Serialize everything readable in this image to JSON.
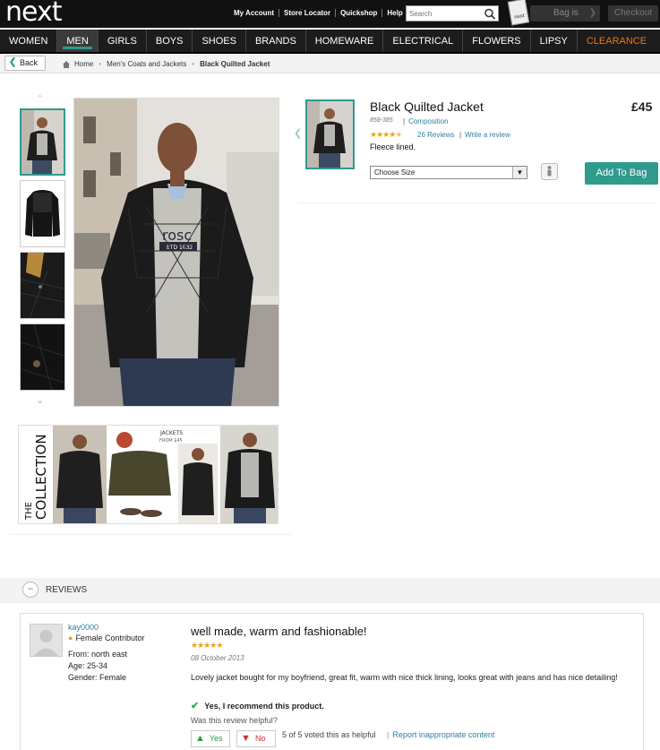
{
  "header": {
    "logo": "next",
    "links": [
      "My Account",
      "Store Locator",
      "Quickshop",
      "Help"
    ],
    "search_placeholder": "Search",
    "bag_icon_label": "next",
    "bag_label": "Bag is",
    "checkout_label": "Checkout"
  },
  "nav": {
    "items": [
      "WOMEN",
      "MEN",
      "GIRLS",
      "BOYS",
      "SHOES",
      "BRANDS",
      "HOMEWARE",
      "ELECTRICAL",
      "FLOWERS",
      "LIPSY",
      "CLEARANCE"
    ],
    "active": "MEN"
  },
  "breadcrumb": {
    "back_label": "Back",
    "items": [
      "Home",
      "Men's Coats and Jackets",
      "Black Quilted Jacket"
    ]
  },
  "product": {
    "title": "Black Quilted Jacket",
    "price": "£45",
    "code": "858-385",
    "composition_link": "Composition",
    "rating": 4.5,
    "reviews_link": "26 Reviews",
    "write_review_link": "Write a review",
    "description": "Fleece lined.",
    "size_placeholder": "Choose Size",
    "add_to_bag_label": "Add To Bag",
    "collection_text_1": "THE",
    "collection_text_2": "COLLECTION",
    "collection_badge_1": "JACKETS",
    "collection_badge_2": "FROM £45",
    "main_image_sweater_text": "rosc",
    "main_image_sweater_subtext": "ETD 1832",
    "colors": {
      "accent": "#2f9a8e",
      "clearance": "#e9780e",
      "link": "#2f7f9f",
      "star": "#e8a317"
    }
  },
  "reviews": {
    "section_label": "REVIEWS",
    "items": [
      {
        "user": "kay0000",
        "badge": "Female Contributor",
        "from": "From: north east",
        "age": "Age: 25-34",
        "gender": "Gender: Female",
        "title": "well made, warm and fashionable!",
        "rating": 5,
        "date": "08 October 2013",
        "body": "Lovely jacket bought for my boyfriend, great fit, warm with nice thick lining, looks great with jeans and has nice detailing!",
        "recommend": "Yes, I recommend this product.",
        "helpful_q": "Was this review helpful?",
        "yes_label": "Yes",
        "no_label": "No",
        "votes": "5 of 5 voted this as helpful",
        "report_link": "Report inappropriate content"
      }
    ]
  }
}
